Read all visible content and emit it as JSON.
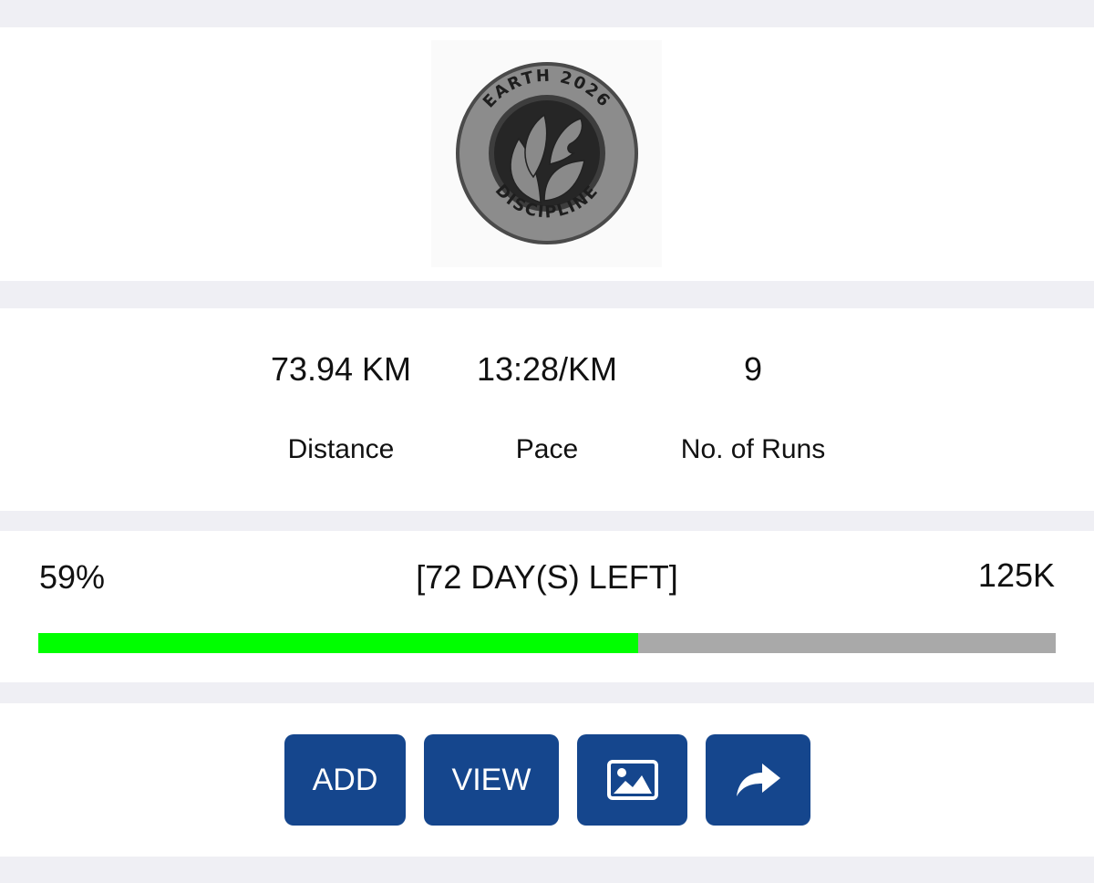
{
  "badge": {
    "top_text": "EARTH 2026",
    "bottom_text": "DISCIPLINE",
    "icon": "medal-leaf-emblem"
  },
  "stats": {
    "distance": {
      "value": "73.94 KM",
      "label": "Distance"
    },
    "pace": {
      "value": "13:28/KM",
      "label": "Pace"
    },
    "runs": {
      "value": "9",
      "label": "No. of Runs"
    }
  },
  "progress": {
    "percent_text": "59%",
    "days_left": "[72 DAY(S) LEFT]",
    "goal": "125K",
    "fraction": 0.59,
    "fill_color": "#00ff00",
    "track_color": "#a9a9a9"
  },
  "actions": {
    "add_label": "ADD",
    "view_label": "VIEW",
    "image_icon": "image-icon",
    "share_icon": "share-icon",
    "button_color": "#15468d"
  }
}
